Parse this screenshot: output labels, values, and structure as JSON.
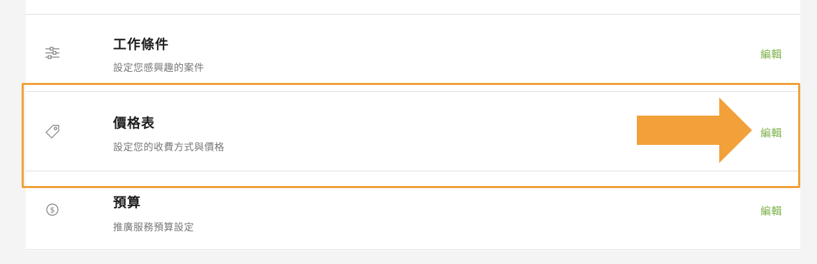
{
  "rows": [
    {
      "title": "工作條件",
      "subtitle": "設定您感興趣的案件",
      "edit_label": "編輯",
      "icon": "sliders-icon"
    },
    {
      "title": "價格表",
      "subtitle": "設定您的收費方式與價格",
      "edit_label": "編輯",
      "icon": "price-tag-icon"
    },
    {
      "title": "預算",
      "subtitle": "推廣服務預算設定",
      "edit_label": "編輯",
      "icon": "dollar-coin-icon"
    }
  ],
  "colors": {
    "edit_link": "#7db24a",
    "highlight": "#f1a03a",
    "arrow": "#f1a03a"
  }
}
